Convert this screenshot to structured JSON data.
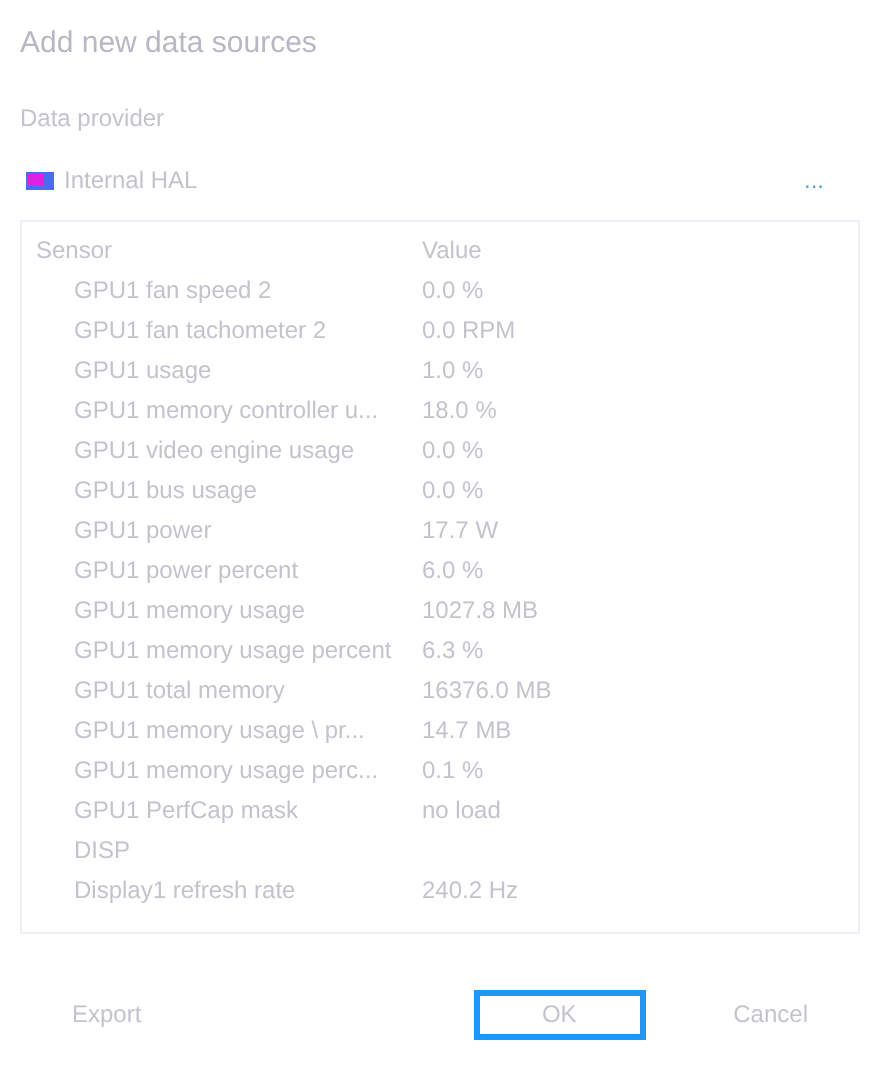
{
  "dialog": {
    "title": "Add new data sources"
  },
  "provider": {
    "label": "Data provider",
    "name": "Internal HAL",
    "more": "..."
  },
  "table": {
    "columns": [
      "Sensor",
      "Value"
    ],
    "rows": [
      {
        "sensor": "GPU1 fan speed 2",
        "value": "0.0 %"
      },
      {
        "sensor": "GPU1 fan tachometer 2",
        "value": "0.0 RPM"
      },
      {
        "sensor": "GPU1 usage",
        "value": "1.0 %"
      },
      {
        "sensor": "GPU1 memory controller u...",
        "value": "18.0 %"
      },
      {
        "sensor": "GPU1 video engine usage",
        "value": "0.0 %"
      },
      {
        "sensor": "GPU1 bus usage",
        "value": "0.0 %"
      },
      {
        "sensor": "GPU1 power",
        "value": "17.7 W"
      },
      {
        "sensor": "GPU1 power percent",
        "value": "6.0 %"
      },
      {
        "sensor": "GPU1 memory usage",
        "value": "1027.8 MB"
      },
      {
        "sensor": "GPU1 memory usage percent",
        "value": "6.3 %"
      },
      {
        "sensor": "GPU1 total memory",
        "value": "16376.0 MB"
      },
      {
        "sensor": "GPU1 memory usage \\ pr...",
        "value": "14.7 MB"
      },
      {
        "sensor": "GPU1 memory usage perc...",
        "value": "0.1 %"
      },
      {
        "sensor": "GPU1 PerfCap mask",
        "value": "no load"
      },
      {
        "sensor": "DISP"
      },
      {
        "sensor": "Display1 refresh rate",
        "value": "240.2 Hz"
      }
    ]
  },
  "buttons": [
    {
      "label": "Export",
      "kind": "plain"
    },
    {
      "label": "OK",
      "kind": "primary"
    },
    {
      "label": "Cancel",
      "kind": "plain"
    }
  ]
}
